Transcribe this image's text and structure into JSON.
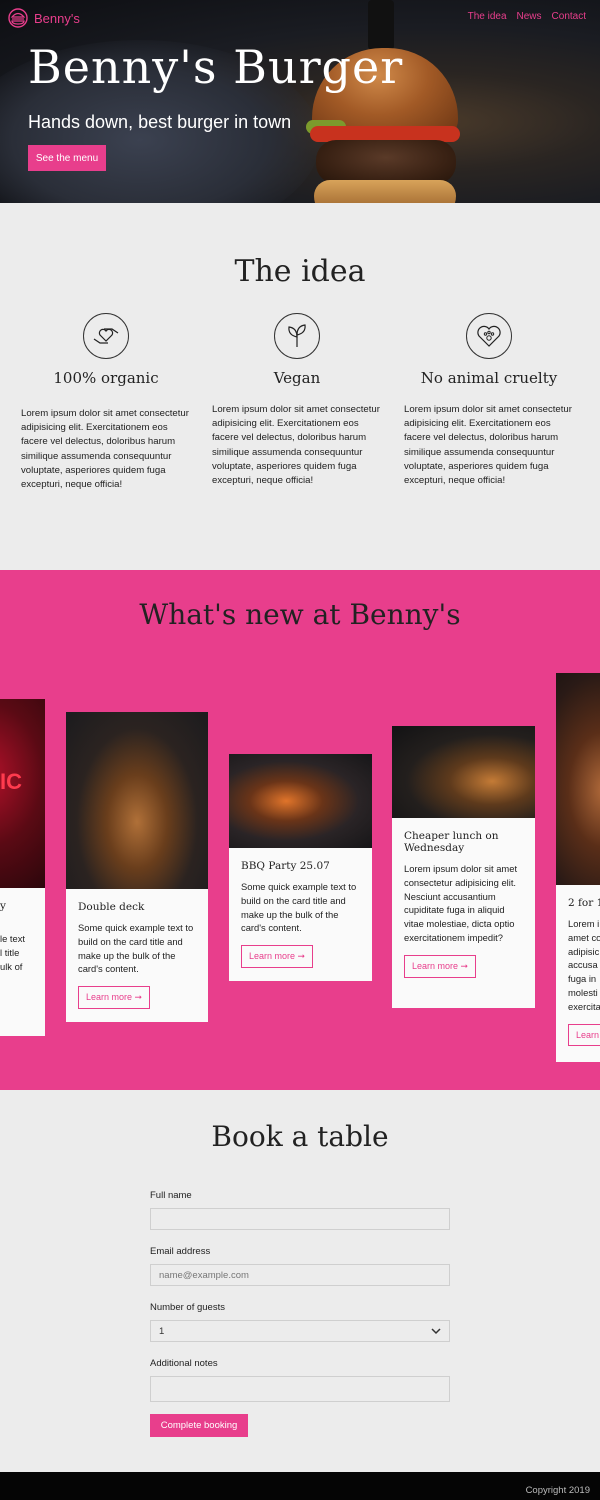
{
  "colors": {
    "accent": "#e83e8c",
    "page_bg": "#ececec",
    "footer_bg": "#050505"
  },
  "header": {
    "brand": "Benny's",
    "nav": [
      "The idea",
      "News",
      "Contact"
    ]
  },
  "hero": {
    "title": "Benny's Burger",
    "tagline": "Hands down, best burger in town",
    "cta": "See the menu"
  },
  "idea": {
    "title": "The idea",
    "features": [
      {
        "icon": "heart-hands-icon",
        "title": "100% organic",
        "text": "Lorem ipsum dolor sit amet consectetur adipisicing elit. Exercitationem eos facere vel delectus, doloribus harum similique assumenda consequuntur voluptate, asperiores quidem fuga excepturi, neque officia!"
      },
      {
        "icon": "leaf-icon",
        "title": "Vegan",
        "text": "Lorem ipsum dolor sit amet consectetur adipisicing elit. Exercitationem eos facere vel delectus, doloribus harum similique assumenda consequuntur voluptate, asperiores quidem fuga excepturi, neque officia!"
      },
      {
        "icon": "paw-heart-icon",
        "title": "No animal cruelty",
        "text": "Lorem ipsum dolor sit amet consectetur adipisicing elit. Exercitationem eos facere vel delectus, doloribus harum similique assumenda consequuntur voluptate, asperiores quidem fuga excepturi, neque officia!"
      }
    ]
  },
  "news": {
    "title": "What's new at Benny's",
    "cards": [
      {
        "title": "y",
        "text": "le text\nl title\nulk of",
        "link": ""
      },
      {
        "title": "Double deck",
        "text": "Some quick example text to build on the card title and make up the bulk of the card's content.",
        "link": "Learn more ➞"
      },
      {
        "title": "BBQ Party 25.07",
        "text": "Some quick example text to build on the card title and make up the bulk of the card's content.",
        "link": "Learn more ➞"
      },
      {
        "title": "Cheaper lunch on Wednesday",
        "text": "Lorem ipsum dolor sit amet consectetur adipisicing elit. Nesciunt accusantium cupiditate fuga in aliquid vitae molestiae, dicta optio exercitationem impedit?",
        "link": "Learn more ➞"
      },
      {
        "title": "2 for 1",
        "text": "Lorem i\namet co\nadipisic\naccusa\nfuga in\nmolesti\nexercita",
        "link": "Learn"
      }
    ]
  },
  "book": {
    "title": "Book a table",
    "name_label": "Full name",
    "name_value": "",
    "email_label": "Email address",
    "email_placeholder": "name@example.com",
    "guests_label": "Number of guests",
    "guests_value": "1",
    "notes_label": "Additional notes",
    "notes_value": "",
    "submit": "Complete booking"
  },
  "footer": {
    "copyright": "Copyright 2019"
  }
}
